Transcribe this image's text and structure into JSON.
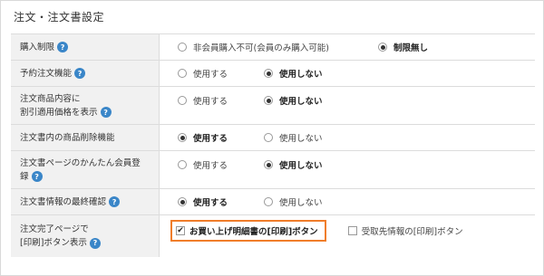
{
  "title": "注文・注文書設定",
  "help_glyph": "?",
  "rows": [
    {
      "label_lines": [
        "購入制限"
      ],
      "options": [
        {
          "label": "非会員購入不可(会員のみ購入可能)",
          "selected": false
        },
        {
          "label": "制限無し",
          "selected": true
        }
      ]
    },
    {
      "label_lines": [
        "予約注文機能"
      ],
      "options": [
        {
          "label": "使用する",
          "selected": false
        },
        {
          "label": "使用しない",
          "selected": true
        }
      ]
    },
    {
      "label_lines": [
        "注文商品内容に",
        "割引適用価格を表示"
      ],
      "options": [
        {
          "label": "使用する",
          "selected": false
        },
        {
          "label": "使用しない",
          "selected": true
        }
      ]
    },
    {
      "label_lines": [
        "注文書内の商品削除機能"
      ],
      "options": [
        {
          "label": "使用する",
          "selected": true
        },
        {
          "label": "使用しない",
          "selected": false
        }
      ]
    },
    {
      "label_lines": [
        "注文書ページのかんたん会員登",
        "録"
      ],
      "options": [
        {
          "label": "使用する",
          "selected": false
        },
        {
          "label": "使用しない",
          "selected": true
        }
      ]
    },
    {
      "label_lines": [
        "注文書情報の最終確認"
      ],
      "options": [
        {
          "label": "使用する",
          "selected": true
        },
        {
          "label": "使用しない",
          "selected": false
        }
      ]
    },
    {
      "label_lines": [
        "注文完了ページで",
        "[印刷]ボタン表示"
      ],
      "checks": [
        {
          "label": "お買い上げ明細書の[印刷]ボタン",
          "checked": true
        },
        {
          "label": "受取先情報の[印刷]ボタン",
          "checked": false
        }
      ]
    }
  ]
}
